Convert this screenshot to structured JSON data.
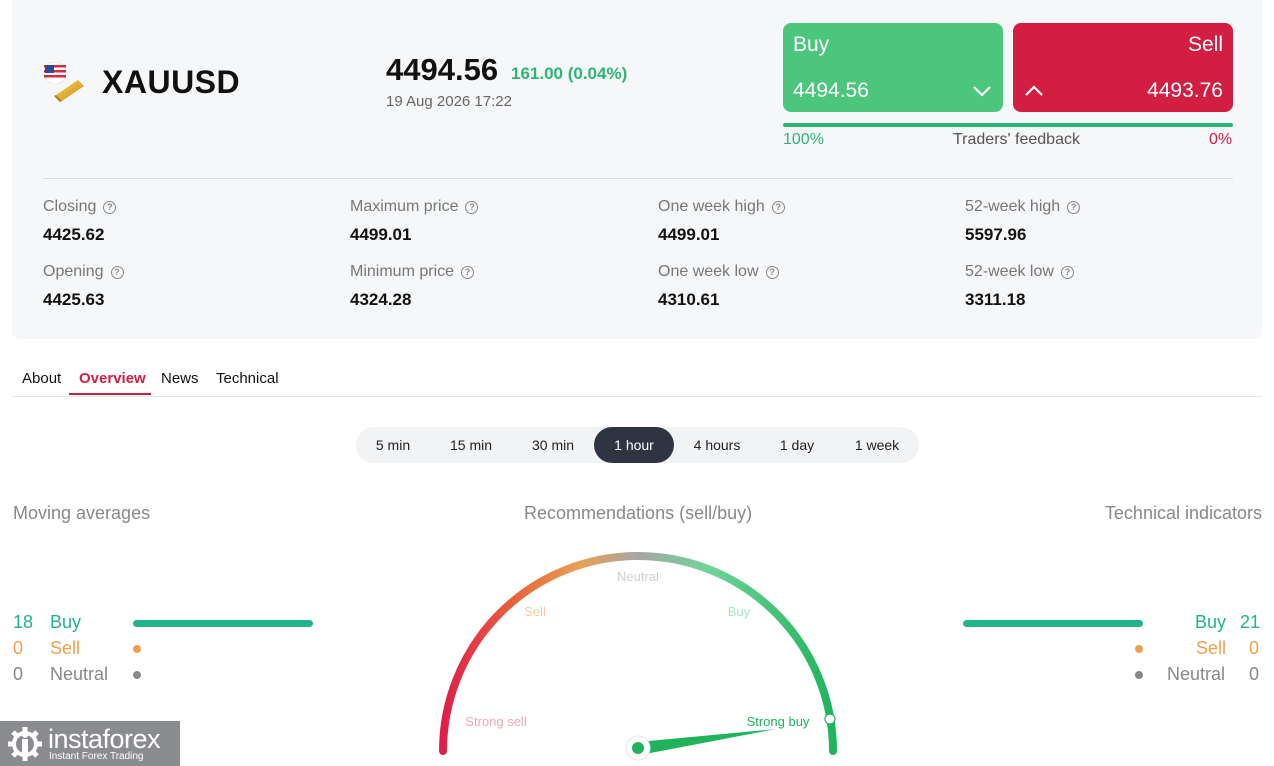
{
  "instrument": {
    "symbol": "XAUUSD",
    "price": "4494.56",
    "change": "161.00 (0.04%)",
    "datetime": "19 Aug 2026 17:22"
  },
  "trade": {
    "buy_label": "Buy",
    "buy_price": "4494.56",
    "sell_label": "Sell",
    "sell_price": "4493.76",
    "feedback_label": "Traders' feedback",
    "feedback_buy": "100%",
    "feedback_sell": "0%",
    "feedback_buy_fraction": 1.0
  },
  "stats": [
    {
      "label": "Closing",
      "value": "4425.62"
    },
    {
      "label": "Maximum price",
      "value": "4499.01"
    },
    {
      "label": "One week high",
      "value": "4499.01"
    },
    {
      "label": "52-week high",
      "value": "5597.96"
    },
    {
      "label": "Opening",
      "value": "4425.63"
    },
    {
      "label": "Minimum price",
      "value": "4324.28"
    },
    {
      "label": "One week low",
      "value": "4310.61"
    },
    {
      "label": "52-week low",
      "value": "3311.18"
    }
  ],
  "tabs": [
    "About",
    "Overview",
    "News",
    "Technical"
  ],
  "active_tab": "Overview",
  "periods": [
    "5 min",
    "15 min",
    "30 min",
    "1 hour",
    "4 hours",
    "1 day",
    "1 week"
  ],
  "active_period": "1 hour",
  "moving_averages": {
    "title": "Moving averages",
    "buy": {
      "label": "Buy",
      "count": "18"
    },
    "sell": {
      "label": "Sell",
      "count": "0"
    },
    "neutral": {
      "label": "Neutral",
      "count": "0"
    }
  },
  "recommendations": {
    "title": "Recommendations (sell/buy)",
    "labels": {
      "strong_sell": "Strong sell",
      "sell": "Sell",
      "neutral": "Neutral",
      "buy": "Buy",
      "strong_buy": "Strong buy"
    },
    "needle_value": "Strong buy"
  },
  "technical_indicators": {
    "title": "Technical indicators",
    "buy": {
      "label": "Buy",
      "count": "21"
    },
    "sell": {
      "label": "Sell",
      "count": "0"
    },
    "neutral": {
      "label": "Neutral",
      "count": "0"
    }
  },
  "brand": {
    "name": "instaforex",
    "tagline": "Instant Forex Trading"
  },
  "colors": {
    "buy": "#4cc67d",
    "sell": "#d21e41",
    "positive": "#2bb673",
    "bar": "#1fb58c",
    "sell_dot": "#f0a04b",
    "neutral_dot": "#888888"
  }
}
